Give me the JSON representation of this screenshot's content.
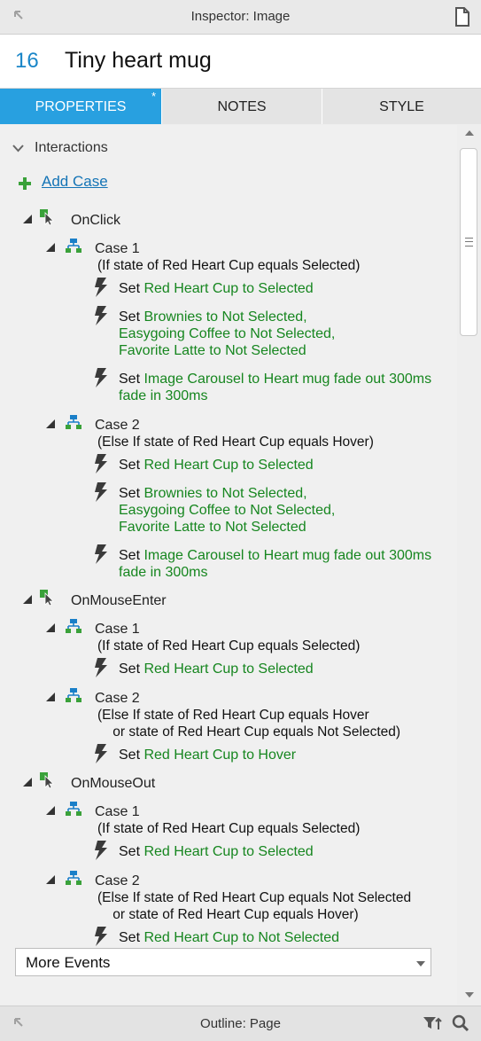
{
  "window": {
    "title": "Inspector: Image"
  },
  "widget": {
    "number": "16",
    "name": "Tiny heart mug"
  },
  "tabs": [
    {
      "label": "PROPERTIES",
      "active": true,
      "modified_marker": "*"
    },
    {
      "label": "NOTES",
      "active": false
    },
    {
      "label": "STYLE",
      "active": false
    }
  ],
  "interactions": {
    "section_label": "Interactions",
    "add_case_label": "Add Case",
    "events": [
      {
        "name": "OnClick",
        "cases": [
          {
            "name": "Case 1",
            "condition": "(If state of Red Heart Cup equals Selected)",
            "actions": [
              {
                "verb": "Set",
                "lines": [
                  "Red Heart Cup to Selected"
                ]
              },
              {
                "verb": "Set",
                "lines": [
                  "Brownies to Not Selected,",
                  "Easygoing Coffee to Not Selected,",
                  "Favorite Latte to Not Selected"
                ]
              },
              {
                "verb": "Set",
                "lines": [
                  "Image Carousel to Heart mug fade out 300ms",
                  "fade in 300ms"
                ]
              }
            ]
          },
          {
            "name": "Case 2",
            "condition": "(Else If state of Red Heart Cup equals Hover)",
            "actions": [
              {
                "verb": "Set",
                "lines": [
                  "Red Heart Cup to Selected"
                ]
              },
              {
                "verb": "Set",
                "lines": [
                  "Brownies to Not Selected,",
                  "Easygoing Coffee to Not Selected,",
                  "Favorite Latte to Not Selected"
                ]
              },
              {
                "verb": "Set",
                "lines": [
                  "Image Carousel to Heart mug fade out 300ms",
                  "fade in 300ms"
                ]
              }
            ]
          }
        ]
      },
      {
        "name": "OnMouseEnter",
        "cases": [
          {
            "name": "Case 1",
            "condition": "(If state of Red Heart Cup equals Selected)",
            "actions": [
              {
                "verb": "Set",
                "lines": [
                  "Red Heart Cup to Selected"
                ]
              }
            ]
          },
          {
            "name": "Case 2",
            "condition": "(Else If state of Red Heart Cup equals Hover\n    or state of Red Heart Cup equals Not Selected)",
            "actions": [
              {
                "verb": "Set",
                "lines": [
                  "Red Heart Cup to Hover"
                ]
              }
            ]
          }
        ]
      },
      {
        "name": "OnMouseOut",
        "cases": [
          {
            "name": "Case 1",
            "condition": "(If state of Red Heart Cup equals Selected)",
            "actions": [
              {
                "verb": "Set",
                "lines": [
                  "Red Heart Cup to Selected"
                ]
              }
            ]
          },
          {
            "name": "Case 2",
            "condition": "(Else If state of Red Heart Cup equals Not Selected\n    or state of Red Heart Cup equals Hover)",
            "actions": [
              {
                "verb": "Set",
                "lines": [
                  "Red Heart Cup to Not Selected"
                ]
              }
            ]
          }
        ]
      }
    ],
    "more_events_label": "More Events"
  },
  "outline": {
    "title": "Outline: Page"
  },
  "icons": {
    "pin": "pin-icon",
    "doc": "document-icon",
    "event": "event-cursor-icon",
    "case": "case-flow-icon",
    "action": "lightning-bolt-icon",
    "filter": "filter-icon",
    "search": "search-icon"
  },
  "colors": {
    "accent": "#28a0e0",
    "action_text": "#16861f",
    "link": "#1474b6",
    "number": "#1a86c8"
  }
}
